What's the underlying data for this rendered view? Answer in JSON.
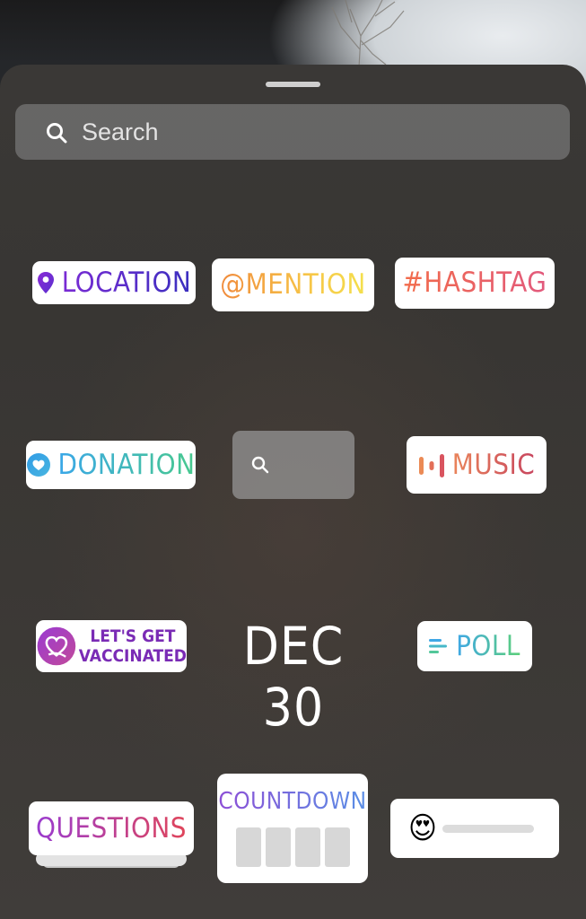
{
  "search": {
    "placeholder": "Search",
    "icon": "search-icon"
  },
  "stickers": {
    "location": "LOCATION",
    "mention": "@MENTION",
    "hashtag": "#HASHTAG",
    "donation": "DONATION",
    "gif_search_icon": "search-icon",
    "music": "MUSIC",
    "vaccinated_line1": "LET'S GET",
    "vaccinated_line2": "VACCINATED",
    "date": "DEC 30",
    "poll": "POLL",
    "questions": "QUESTIONS",
    "countdown": "COUNTDOWN",
    "emoji_slider_emoji": "😍"
  },
  "colors": {
    "location": "#5a2fcf",
    "mention": "#f3a23f",
    "hashtag": "#ec5f5f",
    "donation": "#3db5c8",
    "music": "#d8585f",
    "vaccinated": "#7a2bb5",
    "poll": "#4cbca8",
    "questions": "#c7407a",
    "countdown": "#7f6fe0"
  }
}
